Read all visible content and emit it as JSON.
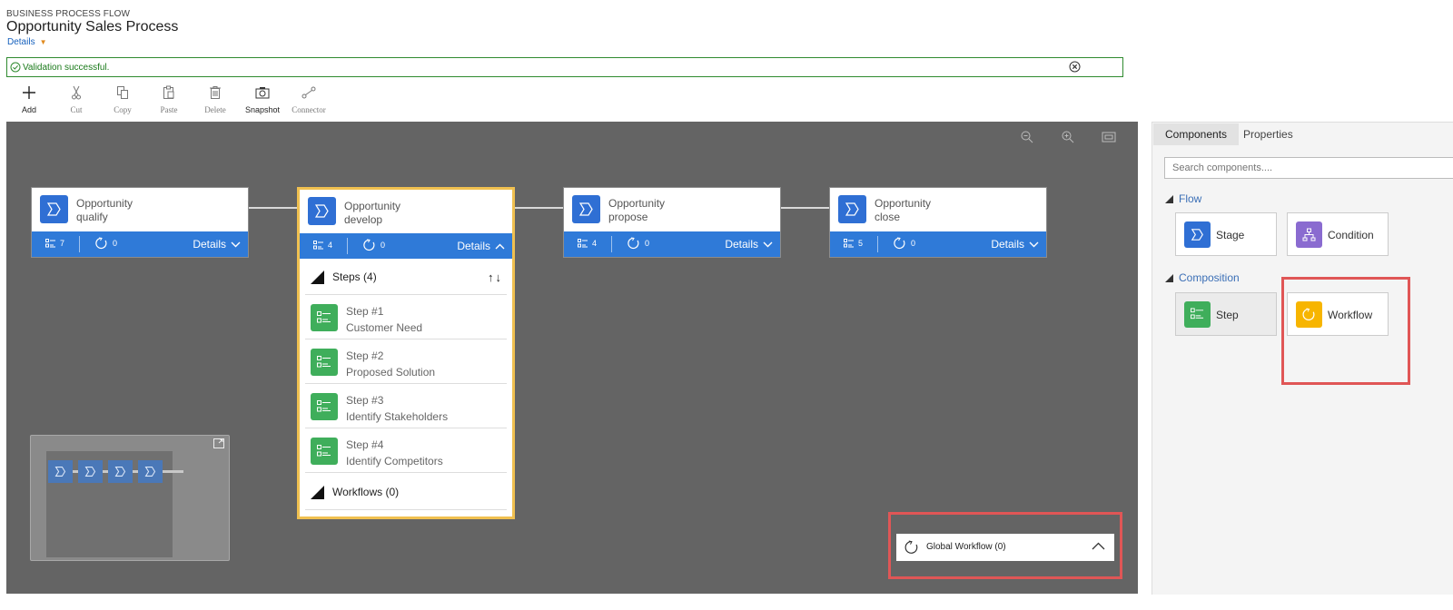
{
  "header": {
    "subtitle": "BUSINESS PROCESS FLOW",
    "title": "Opportunity Sales Process",
    "details_link": "Details"
  },
  "validation": {
    "message": "Validation successful."
  },
  "toolbar": {
    "items": [
      {
        "label": "Add",
        "icon": "plus-icon"
      },
      {
        "label": "Cut",
        "icon": "scissors-icon"
      },
      {
        "label": "Copy",
        "icon": "copy-icon"
      },
      {
        "label": "Paste",
        "icon": "paste-icon"
      },
      {
        "label": "Delete",
        "icon": "trash-icon"
      },
      {
        "label": "Snapshot",
        "icon": "camera-icon"
      },
      {
        "label": "Connector",
        "icon": "connector-icon"
      }
    ]
  },
  "stages": [
    {
      "line1": "Opportunity",
      "line2": "qualify",
      "steps": "7",
      "workflows": "0",
      "details": "Details"
    },
    {
      "line1": "Opportunity",
      "line2": "develop",
      "steps": "4",
      "workflows": "0",
      "details": "Details"
    },
    {
      "line1": "Opportunity",
      "line2": "propose",
      "steps": "4",
      "workflows": "0",
      "details": "Details"
    },
    {
      "line1": "Opportunity",
      "line2": "close",
      "steps": "5",
      "workflows": "0",
      "details": "Details"
    }
  ],
  "expanded": {
    "steps_header": "Steps (4)",
    "steps": [
      {
        "num": "Step #1",
        "name": "Customer Need"
      },
      {
        "num": "Step #2",
        "name": "Proposed Solution"
      },
      {
        "num": "Step #3",
        "name": "Identify Stakeholders"
      },
      {
        "num": "Step #4",
        "name": "Identify Competitors"
      }
    ],
    "workflows_header": "Workflows (0)"
  },
  "global_workflow": {
    "label": "Global Workflow (0)"
  },
  "panel": {
    "tabs": [
      "Components",
      "Properties"
    ],
    "search_placeholder": "Search components....",
    "flow_section": "Flow",
    "flow_items": [
      "Stage",
      "Condition"
    ],
    "composition_section": "Composition",
    "composition_items": [
      "Step",
      "Workflow"
    ]
  },
  "colors": {
    "stage_blue": "#2f7ad8",
    "step_green": "#3fae5b",
    "condition_purple": "#8a6bd0",
    "workflow_yellow": "#f7b500",
    "highlight_red": "#e05656",
    "selected_border": "#f0c050",
    "valid_green": "#2f8a2f"
  }
}
